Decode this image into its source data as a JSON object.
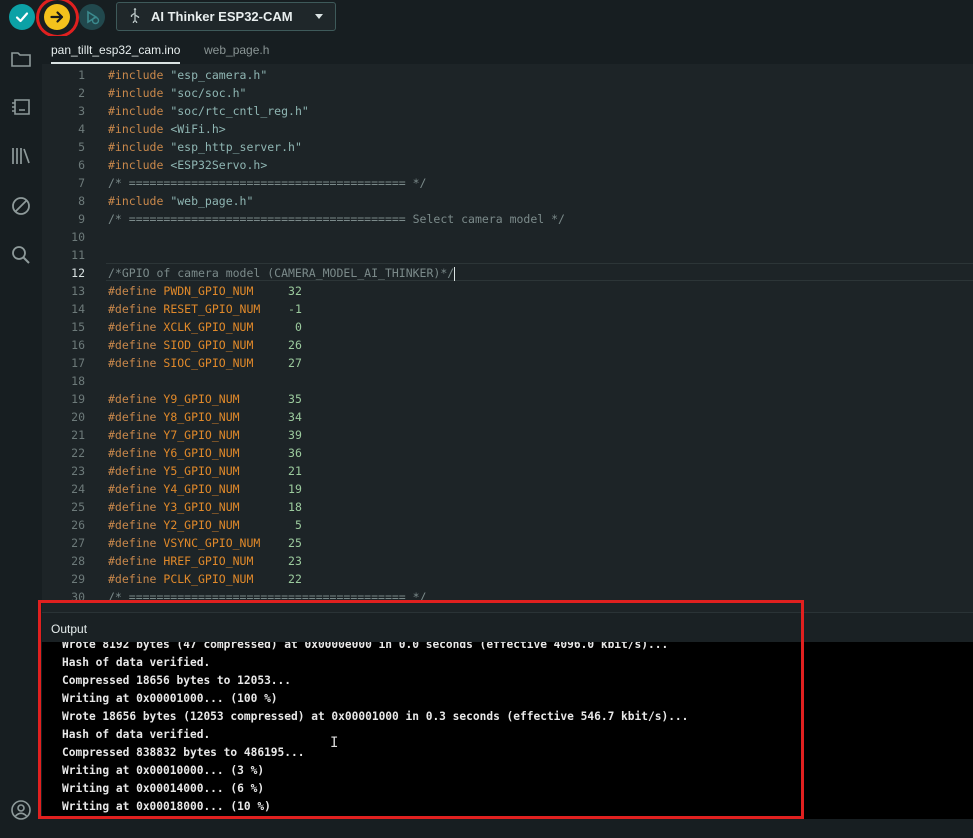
{
  "toolbar": {
    "verify_icon": "checkmark-icon",
    "upload_icon": "arrow-right-icon",
    "debug_icon": "debugger-icon",
    "board": "AI Thinker ESP32-CAM",
    "board_icon": "usb-icon",
    "highlight_color": "#e0201f"
  },
  "sidebar": {
    "icons": [
      "folder-icon",
      "boards-manager-icon",
      "library-icon",
      "debug-icon",
      "search-icon",
      "account-icon"
    ]
  },
  "tabs": [
    {
      "label": "pan_tillt_esp32_cam.ino",
      "active": true
    },
    {
      "label": "web_page.h",
      "active": false
    }
  ],
  "editor": {
    "current_line": 12,
    "lines": [
      {
        "n": "1",
        "kw": "#include",
        "rest": " \"esp_camera.h\"",
        "kind": "include"
      },
      {
        "n": "2",
        "kw": "#include",
        "rest": " \"soc/soc.h\"",
        "kind": "include"
      },
      {
        "n": "3",
        "kw": "#include",
        "rest": " \"soc/rtc_cntl_reg.h\"",
        "kind": "include"
      },
      {
        "n": "4",
        "kw": "#include",
        "rest": " <WiFi.h>",
        "kind": "include"
      },
      {
        "n": "5",
        "kw": "#include",
        "rest": " \"esp_http_server.h\"",
        "kind": "include"
      },
      {
        "n": "6",
        "kw": "#include",
        "rest": " <ESP32Servo.h>",
        "kind": "include"
      },
      {
        "n": "7",
        "kw": "",
        "rest": "/* ======================================== */",
        "kind": "comment"
      },
      {
        "n": "8",
        "kw": "#include",
        "rest": " \"web_page.h\"",
        "kind": "include"
      },
      {
        "n": "9",
        "kw": "",
        "rest": "/* ======================================== Select camera model */",
        "kind": "comment"
      },
      {
        "n": "10",
        "kw": "",
        "rest": "",
        "kind": "blank"
      },
      {
        "n": "11",
        "kw": "",
        "rest": "",
        "kind": "blank"
      },
      {
        "n": "12",
        "kw": "",
        "rest": "/*GPIO of camera model (CAMERA_MODEL_AI_THINKER)*/",
        "kind": "comment"
      },
      {
        "n": "13",
        "kw": "#define",
        "macro": "PWDN_GPIO_NUM",
        "pad": "     ",
        "val": "32",
        "kind": "define"
      },
      {
        "n": "14",
        "kw": "#define",
        "macro": "RESET_GPIO_NUM",
        "pad": "    ",
        "val": "-1",
        "kind": "define"
      },
      {
        "n": "15",
        "kw": "#define",
        "macro": "XCLK_GPIO_NUM",
        "pad": "      ",
        "val": "0",
        "kind": "define"
      },
      {
        "n": "16",
        "kw": "#define",
        "macro": "SIOD_GPIO_NUM",
        "pad": "     ",
        "val": "26",
        "kind": "define"
      },
      {
        "n": "17",
        "kw": "#define",
        "macro": "SIOC_GPIO_NUM",
        "pad": "     ",
        "val": "27",
        "kind": "define"
      },
      {
        "n": "18",
        "kw": "",
        "rest": "",
        "kind": "blank"
      },
      {
        "n": "19",
        "kw": "#define",
        "macro": "Y9_GPIO_NUM",
        "pad": "       ",
        "val": "35",
        "kind": "define"
      },
      {
        "n": "20",
        "kw": "#define",
        "macro": "Y8_GPIO_NUM",
        "pad": "       ",
        "val": "34",
        "kind": "define"
      },
      {
        "n": "21",
        "kw": "#define",
        "macro": "Y7_GPIO_NUM",
        "pad": "       ",
        "val": "39",
        "kind": "define"
      },
      {
        "n": "22",
        "kw": "#define",
        "macro": "Y6_GPIO_NUM",
        "pad": "       ",
        "val": "36",
        "kind": "define"
      },
      {
        "n": "23",
        "kw": "#define",
        "macro": "Y5_GPIO_NUM",
        "pad": "       ",
        "val": "21",
        "kind": "define"
      },
      {
        "n": "24",
        "kw": "#define",
        "macro": "Y4_GPIO_NUM",
        "pad": "       ",
        "val": "19",
        "kind": "define"
      },
      {
        "n": "25",
        "kw": "#define",
        "macro": "Y3_GPIO_NUM",
        "pad": "       ",
        "val": "18",
        "kind": "define"
      },
      {
        "n": "26",
        "kw": "#define",
        "macro": "Y2_GPIO_NUM",
        "pad": "        ",
        "val": "5",
        "kind": "define"
      },
      {
        "n": "27",
        "kw": "#define",
        "macro": "VSYNC_GPIO_NUM",
        "pad": "    ",
        "val": "25",
        "kind": "define"
      },
      {
        "n": "28",
        "kw": "#define",
        "macro": "HREF_GPIO_NUM",
        "pad": "     ",
        "val": "23",
        "kind": "define"
      },
      {
        "n": "29",
        "kw": "#define",
        "macro": "PCLK_GPIO_NUM",
        "pad": "     ",
        "val": "22",
        "kind": "define"
      },
      {
        "n": "30",
        "kw": "",
        "rest": "/* ======================================== */",
        "kind": "comment"
      }
    ]
  },
  "output": {
    "title": "Output",
    "lines": [
      "Wrote 8192 bytes (47 compressed) at 0x0000e000 in 0.0 seconds (effective 4096.0 kbit/s)...",
      "Hash of data verified.",
      "Compressed 18656 bytes to 12053...",
      "Writing at 0x00001000... (100 %)",
      "Wrote 18656 bytes (12053 compressed) at 0x00001000 in 0.3 seconds (effective 546.7 kbit/s)...",
      "Hash of data verified.",
      "Compressed 838832 bytes to 486195...",
      "Writing at 0x00010000... (3 %)",
      "Writing at 0x00014000... (6 %)",
      "Writing at 0x00018000... (10 %)"
    ]
  }
}
